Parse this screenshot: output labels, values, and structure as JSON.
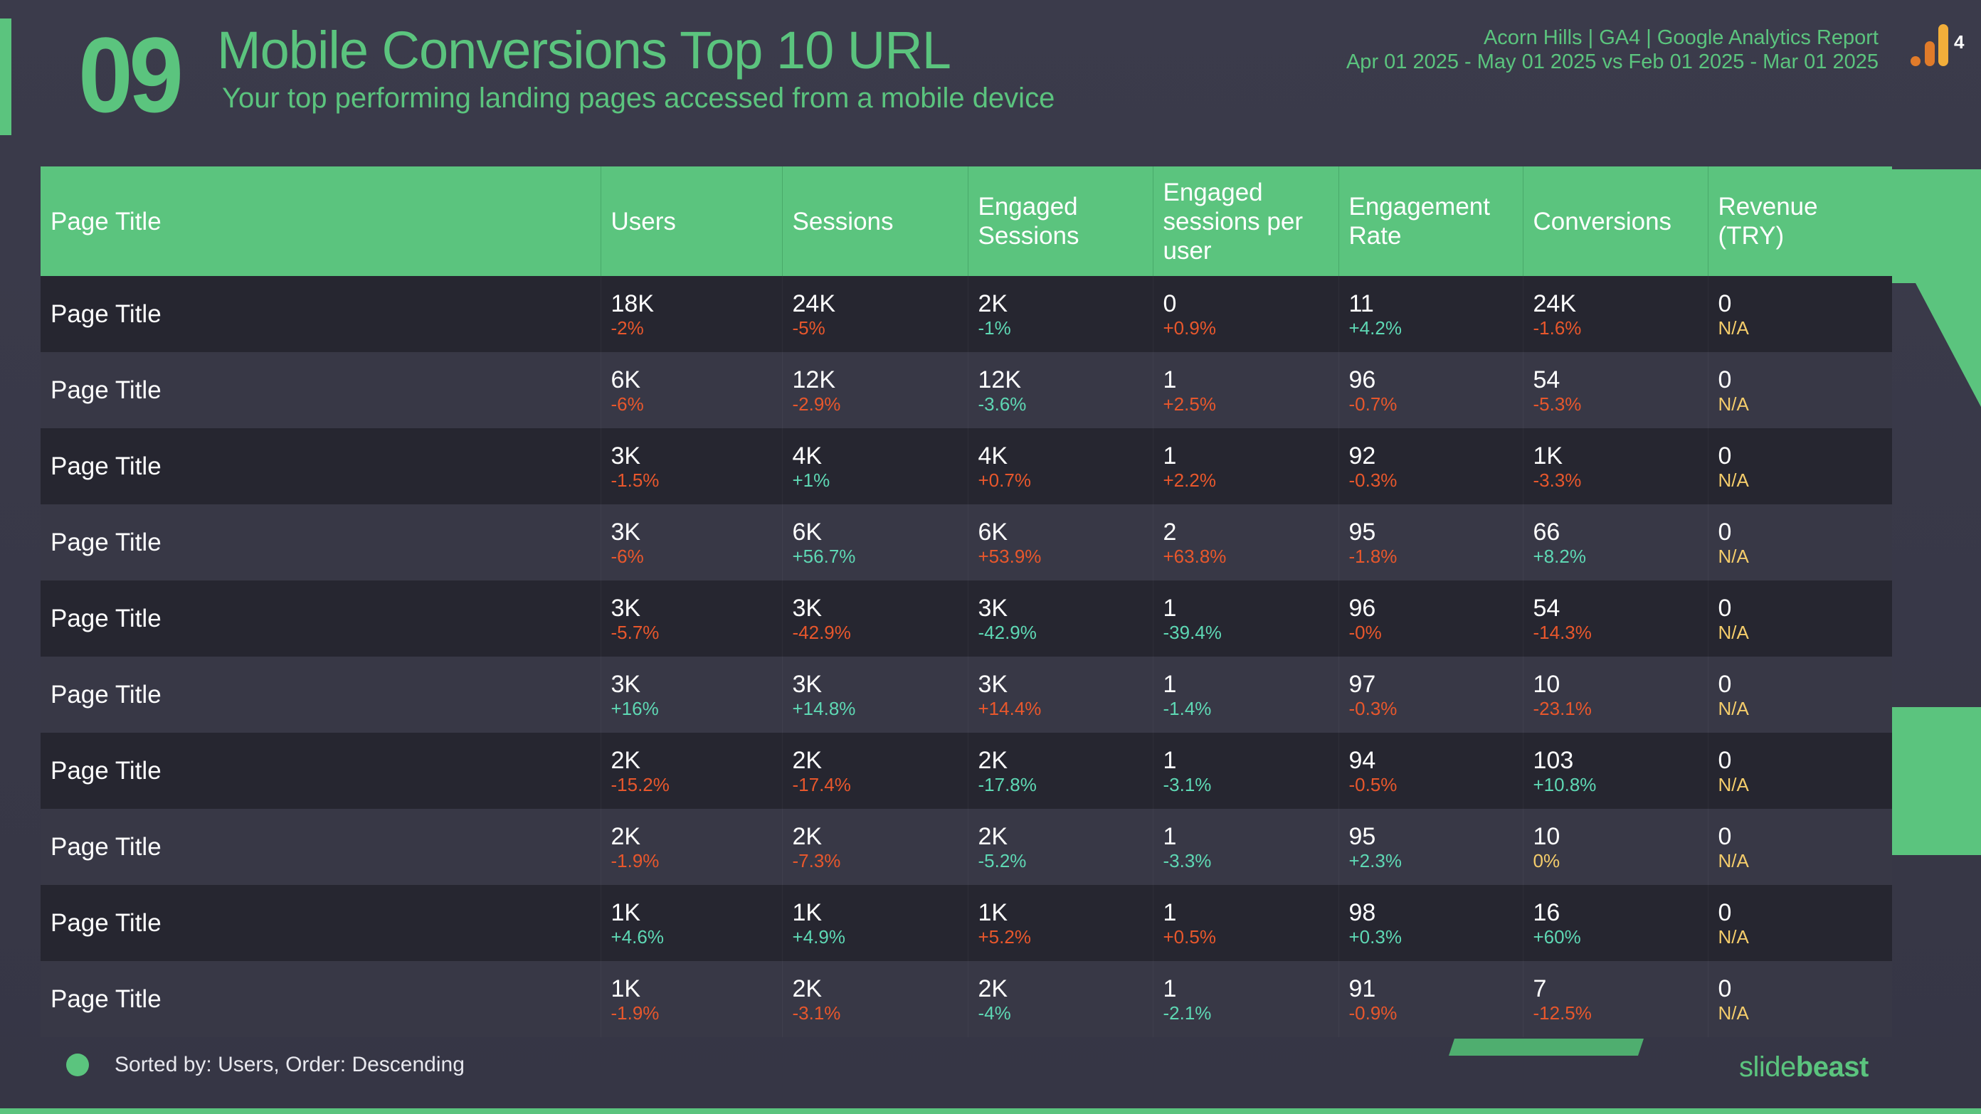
{
  "header": {
    "slide_number": "09",
    "title": "Mobile Conversions Top 10 URL",
    "subtitle": "Your top performing landing pages accessed from a mobile device",
    "report_name": "Acorn Hills | GA4 | Google Analytics Report",
    "date_range": "Apr 01 2025 - May 01 2025 vs Feb 01 2025 - Mar 01 2025",
    "logo_icon": "google-analytics-4-icon",
    "logo_suffix": "4"
  },
  "colors": {
    "accent": "#5bc47e",
    "negative": "#e8572c",
    "positive": "#5ed8b4",
    "neutral": "#f5cd6b",
    "ga_orange_dark": "#e07b2a",
    "ga_orange_light": "#f2ae3a"
  },
  "table": {
    "columns": [
      "Page Title",
      "Users",
      "Sessions",
      "Engaged Sessions",
      "Engaged sessions per user",
      "Engagement Rate",
      "Conversions",
      "Revenue (TRY)"
    ],
    "rows": [
      {
        "page": "Page Title",
        "cells": [
          {
            "v": "18K",
            "d": "-2%",
            "s": "neg"
          },
          {
            "v": "24K",
            "d": "-5%",
            "s": "neg"
          },
          {
            "v": "2K",
            "d": "-1%",
            "s": "pos"
          },
          {
            "v": "0",
            "d": "+0.9%",
            "s": "neg"
          },
          {
            "v": "11",
            "d": "+4.2%",
            "s": "pos"
          },
          {
            "v": "24K",
            "d": "-1.6%",
            "s": "neg"
          },
          {
            "v": "0",
            "d": "N/A",
            "s": "neutral"
          }
        ]
      },
      {
        "page": "Page Title",
        "cells": [
          {
            "v": "6K",
            "d": "-6%",
            "s": "neg"
          },
          {
            "v": "12K",
            "d": "-2.9%",
            "s": "neg"
          },
          {
            "v": "12K",
            "d": "-3.6%",
            "s": "pos"
          },
          {
            "v": "1",
            "d": "+2.5%",
            "s": "neg"
          },
          {
            "v": "96",
            "d": "-0.7%",
            "s": "neg"
          },
          {
            "v": "54",
            "d": "-5.3%",
            "s": "neg"
          },
          {
            "v": "0",
            "d": "N/A",
            "s": "neutral"
          }
        ]
      },
      {
        "page": "Page Title",
        "cells": [
          {
            "v": "3K",
            "d": "-1.5%",
            "s": "neg"
          },
          {
            "v": "4K",
            "d": "+1%",
            "s": "pos"
          },
          {
            "v": "4K",
            "d": "+0.7%",
            "s": "neg"
          },
          {
            "v": "1",
            "d": "+2.2%",
            "s": "neg"
          },
          {
            "v": "92",
            "d": "-0.3%",
            "s": "neg"
          },
          {
            "v": "1K",
            "d": "-3.3%",
            "s": "neg"
          },
          {
            "v": "0",
            "d": "N/A",
            "s": "neutral"
          }
        ]
      },
      {
        "page": "Page Title",
        "cells": [
          {
            "v": "3K",
            "d": "-6%",
            "s": "neg"
          },
          {
            "v": "6K",
            "d": "+56.7%",
            "s": "pos"
          },
          {
            "v": "6K",
            "d": "+53.9%",
            "s": "neg"
          },
          {
            "v": "2",
            "d": "+63.8%",
            "s": "neg"
          },
          {
            "v": "95",
            "d": "-1.8%",
            "s": "neg"
          },
          {
            "v": "66",
            "d": "+8.2%",
            "s": "pos"
          },
          {
            "v": "0",
            "d": "N/A",
            "s": "neutral"
          }
        ]
      },
      {
        "page": "Page Title",
        "cells": [
          {
            "v": "3K",
            "d": "-5.7%",
            "s": "neg"
          },
          {
            "v": "3K",
            "d": "-42.9%",
            "s": "neg"
          },
          {
            "v": "3K",
            "d": "-42.9%",
            "s": "pos"
          },
          {
            "v": "1",
            "d": "-39.4%",
            "s": "pos"
          },
          {
            "v": "96",
            "d": "-0%",
            "s": "neg"
          },
          {
            "v": "54",
            "d": "-14.3%",
            "s": "neg"
          },
          {
            "v": "0",
            "d": "N/A",
            "s": "neutral"
          }
        ]
      },
      {
        "page": "Page Title",
        "cells": [
          {
            "v": "3K",
            "d": "+16%",
            "s": "pos"
          },
          {
            "v": "3K",
            "d": "+14.8%",
            "s": "pos"
          },
          {
            "v": "3K",
            "d": "+14.4%",
            "s": "neg"
          },
          {
            "v": "1",
            "d": "-1.4%",
            "s": "pos"
          },
          {
            "v": "97",
            "d": "-0.3%",
            "s": "neg"
          },
          {
            "v": "10",
            "d": "-23.1%",
            "s": "neg"
          },
          {
            "v": "0",
            "d": "N/A",
            "s": "neutral"
          }
        ]
      },
      {
        "page": "Page Title",
        "cells": [
          {
            "v": "2K",
            "d": "-15.2%",
            "s": "neg"
          },
          {
            "v": "2K",
            "d": "-17.4%",
            "s": "neg"
          },
          {
            "v": "2K",
            "d": "-17.8%",
            "s": "pos"
          },
          {
            "v": "1",
            "d": "-3.1%",
            "s": "pos"
          },
          {
            "v": "94",
            "d": "-0.5%",
            "s": "neg"
          },
          {
            "v": "103",
            "d": "+10.8%",
            "s": "pos"
          },
          {
            "v": "0",
            "d": "N/A",
            "s": "neutral"
          }
        ]
      },
      {
        "page": "Page Title",
        "cells": [
          {
            "v": "2K",
            "d": "-1.9%",
            "s": "neg"
          },
          {
            "v": "2K",
            "d": "-7.3%",
            "s": "neg"
          },
          {
            "v": "2K",
            "d": "-5.2%",
            "s": "pos"
          },
          {
            "v": "1",
            "d": "-3.3%",
            "s": "pos"
          },
          {
            "v": "95",
            "d": "+2.3%",
            "s": "pos"
          },
          {
            "v": "10",
            "d": "0%",
            "s": "neutral"
          },
          {
            "v": "0",
            "d": "N/A",
            "s": "neutral"
          }
        ]
      },
      {
        "page": "Page Title",
        "cells": [
          {
            "v": "1K",
            "d": "+4.6%",
            "s": "pos"
          },
          {
            "v": "1K",
            "d": "+4.9%",
            "s": "pos"
          },
          {
            "v": "1K",
            "d": "+5.2%",
            "s": "neg"
          },
          {
            "v": "1",
            "d": "+0.5%",
            "s": "neg"
          },
          {
            "v": "98",
            "d": "+0.3%",
            "s": "pos"
          },
          {
            "v": "16",
            "d": "+60%",
            "s": "pos"
          },
          {
            "v": "0",
            "d": "N/A",
            "s": "neutral"
          }
        ]
      },
      {
        "page": "Page Title",
        "cells": [
          {
            "v": "1K",
            "d": "-1.9%",
            "s": "neg"
          },
          {
            "v": "2K",
            "d": "-3.1%",
            "s": "neg"
          },
          {
            "v": "2K",
            "d": "-4%",
            "s": "pos"
          },
          {
            "v": "1",
            "d": "-2.1%",
            "s": "pos"
          },
          {
            "v": "91",
            "d": "-0.9%",
            "s": "neg"
          },
          {
            "v": "7",
            "d": "-12.5%",
            "s": "neg"
          },
          {
            "v": "0",
            "d": "N/A",
            "s": "neutral"
          }
        ]
      }
    ]
  },
  "footer": {
    "sort_note": "Sorted by: Users, Order: Descending",
    "brand_light": "slide",
    "brand_bold": "beast"
  }
}
